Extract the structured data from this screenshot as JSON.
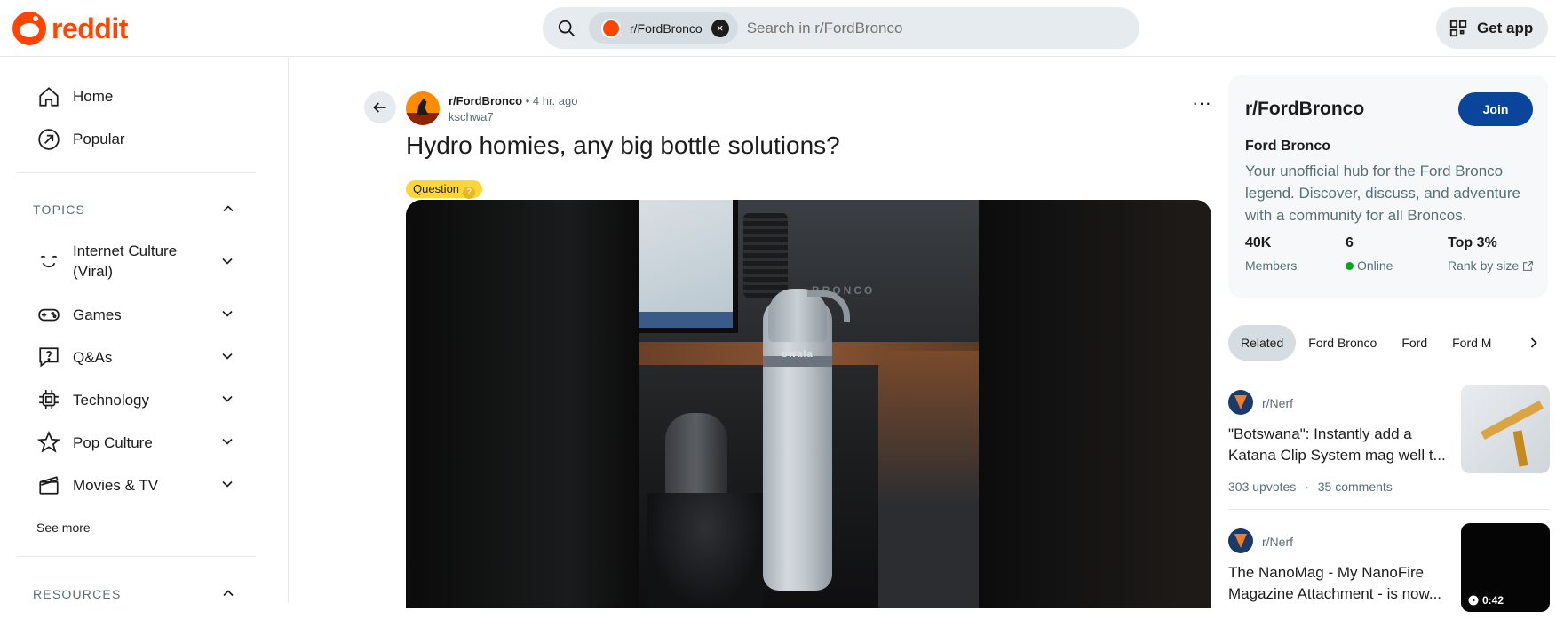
{
  "header": {
    "logo_text": "reddit",
    "search_chip": "r/FordBronco",
    "search_placeholder": "Search in r/FordBronco",
    "get_app_label": "Get app"
  },
  "sidebar": {
    "nav": [
      {
        "label": "Home",
        "icon": "home-icon"
      },
      {
        "label": "Popular",
        "icon": "popular-icon"
      }
    ],
    "topics_title": "TOPICS",
    "topics": [
      {
        "label": "Internet Culture (Viral)",
        "icon": "smiley-icon"
      },
      {
        "label": "Games",
        "icon": "gamepad-icon"
      },
      {
        "label": "Q&As",
        "icon": "question-icon"
      },
      {
        "label": "Technology",
        "icon": "chip-icon"
      },
      {
        "label": "Pop Culture",
        "icon": "star-icon"
      },
      {
        "label": "Movies & TV",
        "icon": "clapper-icon"
      }
    ],
    "see_more": "See more",
    "resources_title": "RESOURCES"
  },
  "post": {
    "subreddit": "r/FordBronco",
    "time": "4 hr. ago",
    "separator": "•",
    "author": "kschwa7",
    "title": "Hydro homies, any big bottle solutions?",
    "flair": "Question",
    "flair_emoji": "?",
    "image_text": "BRONCO",
    "bottle_brand": "owala"
  },
  "about": {
    "name": "r/FordBronco",
    "join_label": "Join",
    "title": "Ford Bronco",
    "description": "Your unofficial hub for the Ford Bronco legend. Discover, discuss, and adventure with a community for all Broncos.",
    "stats": [
      {
        "value": "40K",
        "label": "Members"
      },
      {
        "value": "6",
        "label": "Online"
      },
      {
        "value": "Top 3%",
        "label": "Rank by size"
      }
    ]
  },
  "related": {
    "tabs": [
      "Related",
      "Ford Bronco",
      "Ford",
      "Ford M"
    ],
    "posts": [
      {
        "subreddit": "r/Nerf",
        "title_line1": "\"Botswana\": Instantly add a",
        "title_line2": "Katana Clip System mag well t...",
        "upvotes": "303 upvotes",
        "dot": "·",
        "comments": "35 comments"
      },
      {
        "subreddit": "r/Nerf",
        "title_line1": "The NanoMag - My NanoFire",
        "title_line2": "Magazine Attachment - is now...",
        "duration": "0:42"
      }
    ]
  },
  "colors": {
    "brand": "#ff4500",
    "join": "#0a449b",
    "flair": "#ffd635",
    "online": "#01a816"
  }
}
